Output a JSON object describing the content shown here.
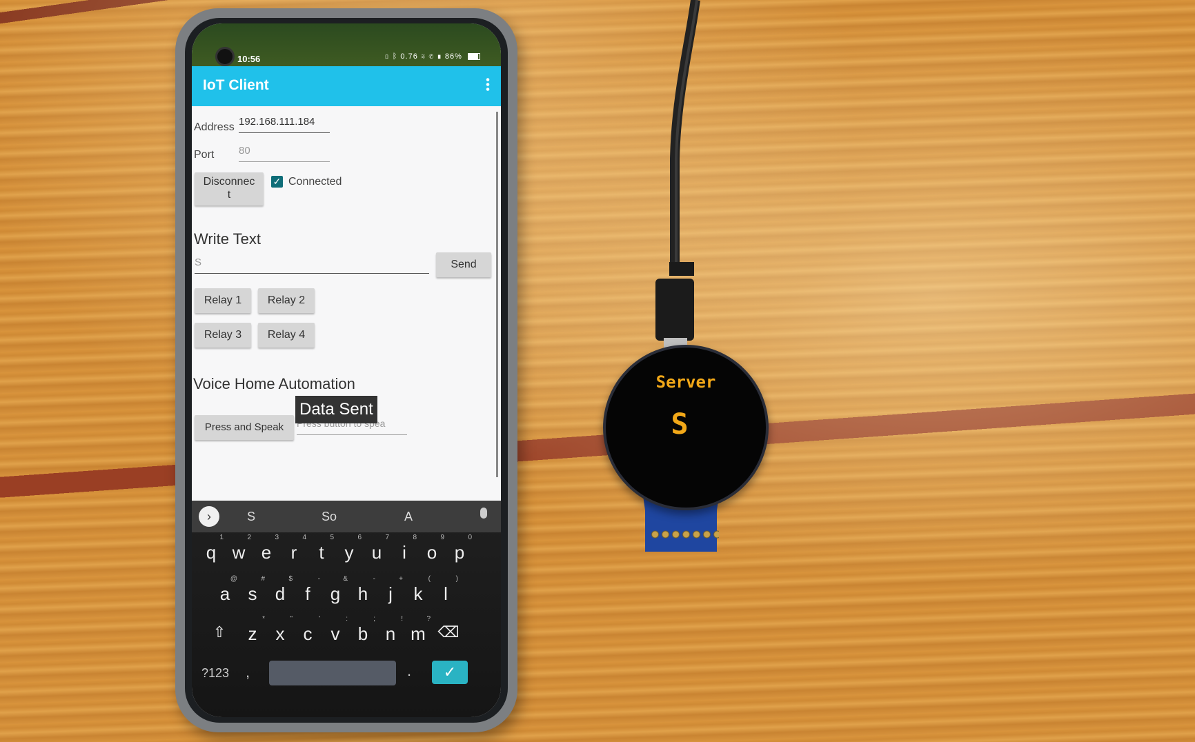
{
  "status_bar": {
    "time": "10:56",
    "speed": "0.76",
    "battery": "86%"
  },
  "app": {
    "title": "IoT Client"
  },
  "connection": {
    "address_label": "Address",
    "address_value": "192.168.111.184",
    "port_label": "Port",
    "port_hint": "80",
    "disconnect_label": "Disconnec\nt",
    "connected_label": "Connected",
    "connected_checked": true
  },
  "write_text": {
    "heading": "Write Text",
    "input_value": "S",
    "send_label": "Send"
  },
  "relays": {
    "r1": "Relay 1",
    "r2": "Relay 2",
    "r3": "Relay 3",
    "r4": "Relay 4"
  },
  "voice": {
    "heading": "Voice Home Automation",
    "press_label": "Press and Speak",
    "hint": "Press button to spea"
  },
  "toast": {
    "text": "Data Sent"
  },
  "keyboard": {
    "suggestions": [
      "S",
      "So",
      "A"
    ],
    "row1": [
      "q",
      "w",
      "e",
      "r",
      "t",
      "y",
      "u",
      "i",
      "o",
      "p"
    ],
    "row1_alt": [
      "1",
      "2",
      "3",
      "4",
      "5",
      "6",
      "7",
      "8",
      "9",
      "0"
    ],
    "row2": [
      "a",
      "s",
      "d",
      "f",
      "g",
      "h",
      "j",
      "k",
      "l"
    ],
    "row2_alt": [
      "@",
      "#",
      "$",
      "-",
      "&",
      "-",
      "+",
      "(",
      ")"
    ],
    "row3": [
      "z",
      "x",
      "c",
      "v",
      "b",
      "n",
      "m"
    ],
    "row3_alt": [
      "*",
      "\"",
      "'",
      ":",
      ";",
      "!",
      "?"
    ],
    "numbers_key": "?123",
    "dot_key": ".",
    "comma_key": ",",
    "enter_symbol": "✓",
    "arrow_symbol": "›"
  },
  "device_display": {
    "title": "Server",
    "text": "S"
  },
  "colors": {
    "appbar": "#20c1ea",
    "accent_check": "#0f6d78",
    "display_text": "#f2a818",
    "pcb": "#1f46a0"
  }
}
